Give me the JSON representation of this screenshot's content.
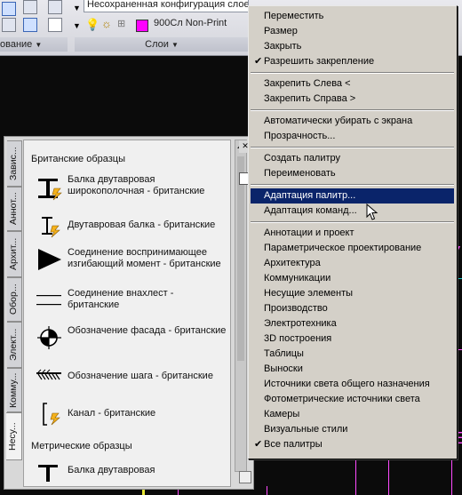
{
  "ribbon": {
    "combo_config": "Несохраненная конфигурация слое",
    "combo_layer": "900Сл Non-Print",
    "panel_left_title": "ование",
    "panel_layers_title": "Слои"
  },
  "palette": {
    "tabs": [
      "Завис...",
      "Аннот...",
      "Архит...",
      "Обор...",
      "Элект...",
      "Комму...",
      "Несу..."
    ],
    "section1": "Британские образцы",
    "tools": [
      {
        "icon": "i-beam-icon",
        "label": "Балка двутавровая широкополочная - британские"
      },
      {
        "icon": "i-beam-small-icon",
        "label": "Двутавровая балка - британские"
      },
      {
        "icon": "moment-connection-icon",
        "label": "Соединение воспринимающее изгибающий момент - британские"
      },
      {
        "icon": "lap-joint-icon",
        "label": "Соединение внахлест - британские"
      },
      {
        "icon": "elevation-mark-icon",
        "label": "Обозначение фасада - британские"
      },
      {
        "icon": "pitch-mark-icon",
        "label": "Обозначение шага - британские"
      },
      {
        "icon": "channel-icon",
        "label": "Канал - британские"
      }
    ],
    "section2": "Метрические образцы",
    "tool_last": "Балка двутавровая"
  },
  "menu": {
    "items": [
      {
        "label": "Переместить",
        "checked": false,
        "highlighted": false
      },
      {
        "label": "Размер",
        "checked": false,
        "highlighted": false
      },
      {
        "label": "Закрыть",
        "checked": false,
        "highlighted": false
      },
      {
        "label": "Разрешить закрепление",
        "checked": true,
        "highlighted": false
      },
      {
        "sep": true
      },
      {
        "label": "Закрепить Слева <",
        "checked": false,
        "highlighted": false
      },
      {
        "label": "Закрепить Справа  >",
        "checked": false,
        "highlighted": false
      },
      {
        "sep": true
      },
      {
        "label": "Автоматически убирать с экрана",
        "checked": false,
        "highlighted": false
      },
      {
        "label": "Прозрачность...",
        "checked": false,
        "highlighted": false
      },
      {
        "sep": true
      },
      {
        "label": "Создать палитру",
        "checked": false,
        "highlighted": false
      },
      {
        "label": "Переименовать",
        "checked": false,
        "highlighted": false
      },
      {
        "sep": true
      },
      {
        "label": "Адаптация палитр...",
        "checked": false,
        "highlighted": true
      },
      {
        "label": "Адаптация команд...",
        "checked": false,
        "highlighted": false
      },
      {
        "sep": true
      },
      {
        "label": "Аннотации и проект",
        "checked": false,
        "highlighted": false
      },
      {
        "label": "Параметрическое проектирование",
        "checked": false,
        "highlighted": false
      },
      {
        "label": "Архитектура",
        "checked": false,
        "highlighted": false
      },
      {
        "label": "Коммуникации",
        "checked": false,
        "highlighted": false
      },
      {
        "label": "Несущие элементы",
        "checked": false,
        "highlighted": false
      },
      {
        "label": "Производство",
        "checked": false,
        "highlighted": false
      },
      {
        "label": "Электротехника",
        "checked": false,
        "highlighted": false
      },
      {
        "label": "3D построения",
        "checked": false,
        "highlighted": false
      },
      {
        "label": "Таблицы",
        "checked": false,
        "highlighted": false
      },
      {
        "label": "Выноски",
        "checked": false,
        "highlighted": false
      },
      {
        "label": "Источники света общего назначения",
        "checked": false,
        "highlighted": false
      },
      {
        "label": "Фотометрические источники света",
        "checked": false,
        "highlighted": false
      },
      {
        "label": "Камеры",
        "checked": false,
        "highlighted": false
      },
      {
        "label": "Визуальные стили",
        "checked": false,
        "highlighted": false
      },
      {
        "label": "Все палитры",
        "checked": true,
        "highlighted": false
      }
    ]
  },
  "colors": {
    "highlight": "#0a246a",
    "layer_swatch": "#ff00ff",
    "drawing_line": "#ff4bff",
    "lightning": "#f5b21b"
  }
}
